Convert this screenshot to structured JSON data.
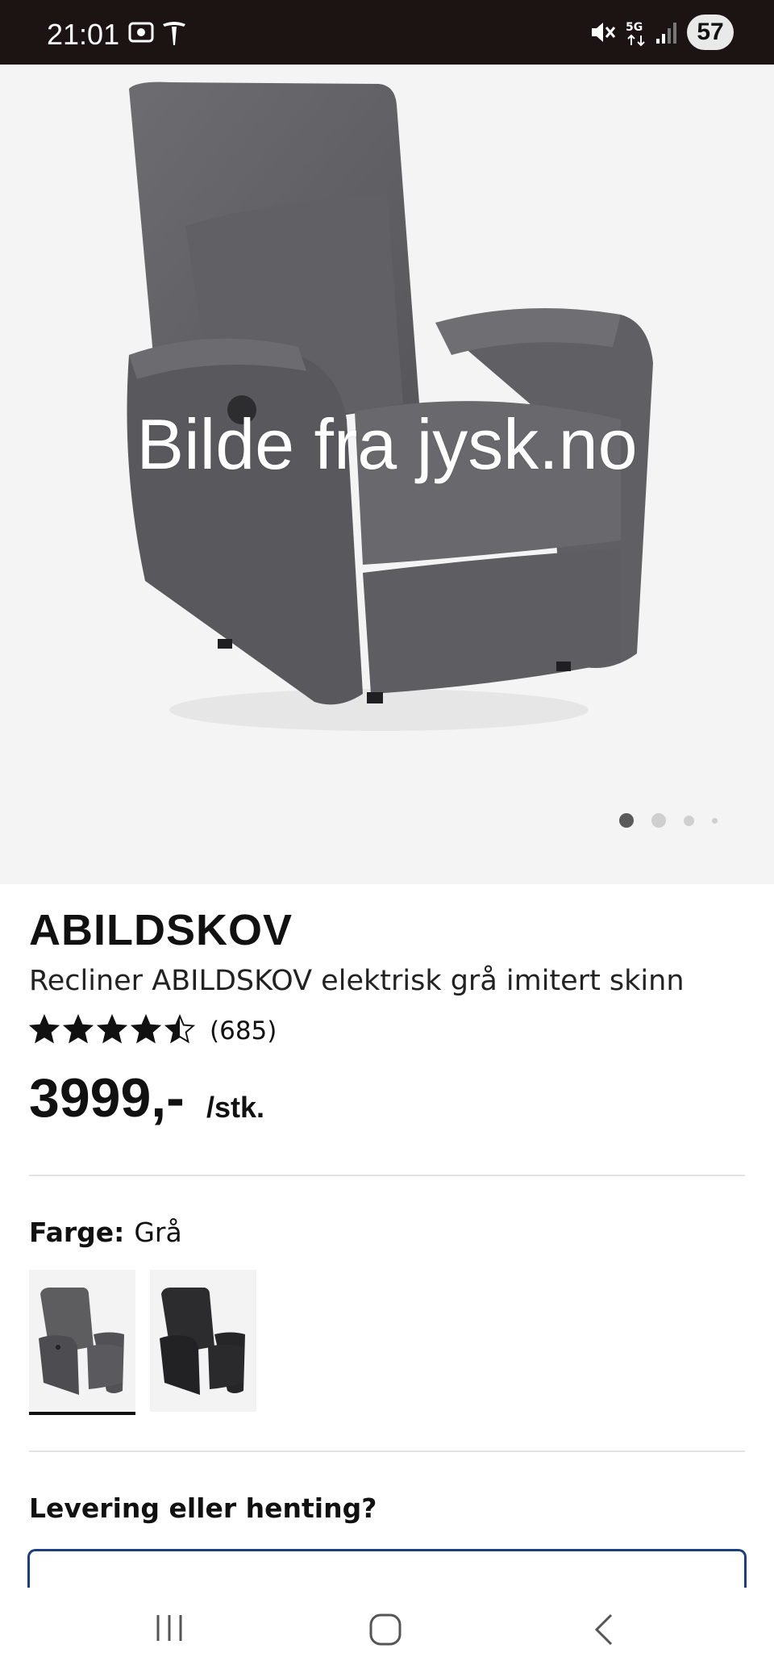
{
  "status_bar": {
    "time": "21:01",
    "battery": "57"
  },
  "hero": {
    "watermark": "Bilde fra jysk.no",
    "active_slide_index": 1,
    "slide_count": 4
  },
  "product": {
    "brand": "ABILDSKOV",
    "name": "Recliner ABILDSKOV elektrisk grå imitert skinn",
    "rating_value": 4.5,
    "rating_max": 5,
    "rating_count": "(685)",
    "price": "3999,-",
    "unit": "/stk."
  },
  "color": {
    "label": "Farge:",
    "value": "Grå",
    "options": [
      {
        "name": "Grå",
        "color": "#5d5d60",
        "selected": true
      },
      {
        "name": "Svart",
        "color": "#2a2a2c",
        "selected": false
      }
    ]
  },
  "delivery": {
    "heading": "Levering eller henting?"
  },
  "colors": {
    "status_bar_bg": "#1b1412",
    "accent_border": "#1c3f80",
    "chair_gray": "#6c6c70"
  }
}
